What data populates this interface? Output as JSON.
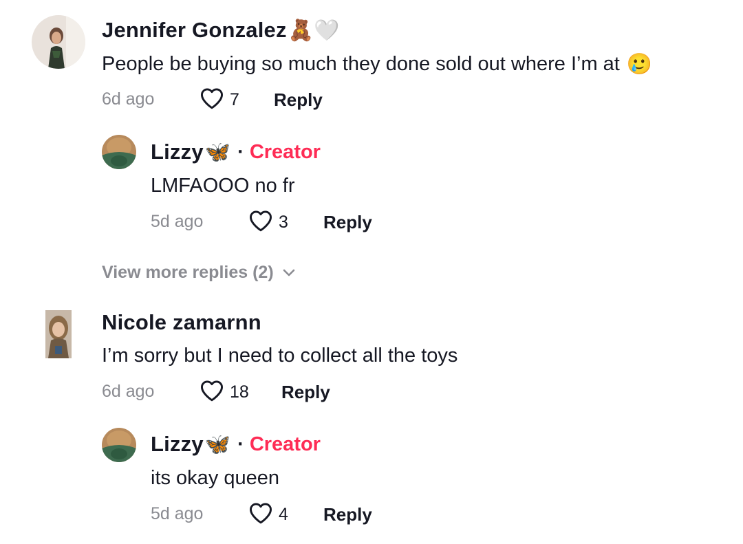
{
  "colors": {
    "accent": "#fe2c55",
    "muted": "#8a8b91",
    "text": "#161823"
  },
  "comments": [
    {
      "author": "Jennifer Gonzalez",
      "author_emojis": "🧸🤍",
      "text": "People be buying so much they done sold out where I’m at",
      "trailing_emoji": "🥲",
      "time": "6d ago",
      "likes": "7",
      "reply_label": "Reply",
      "replies": [
        {
          "author": "Lizzy",
          "author_emoji": "🦋",
          "separator": "·",
          "badge": "Creator",
          "text": "LMFAOOO no fr",
          "time": "5d ago",
          "likes": "3",
          "reply_label": "Reply"
        }
      ],
      "view_more": "View more replies (2)"
    },
    {
      "author": "Nicole zamarnn",
      "text": "I’m sorry but I need to collect all the toys",
      "time": "6d ago",
      "likes": "18",
      "reply_label": "Reply",
      "replies": [
        {
          "author": "Lizzy",
          "author_emoji": "🦋",
          "separator": "·",
          "badge": "Creator",
          "text": "its okay queen",
          "time": "5d ago",
          "likes": "4",
          "reply_label": "Reply"
        }
      ]
    }
  ],
  "icons": {
    "like": "heart-outline-icon",
    "expand": "chevron-down-icon"
  }
}
